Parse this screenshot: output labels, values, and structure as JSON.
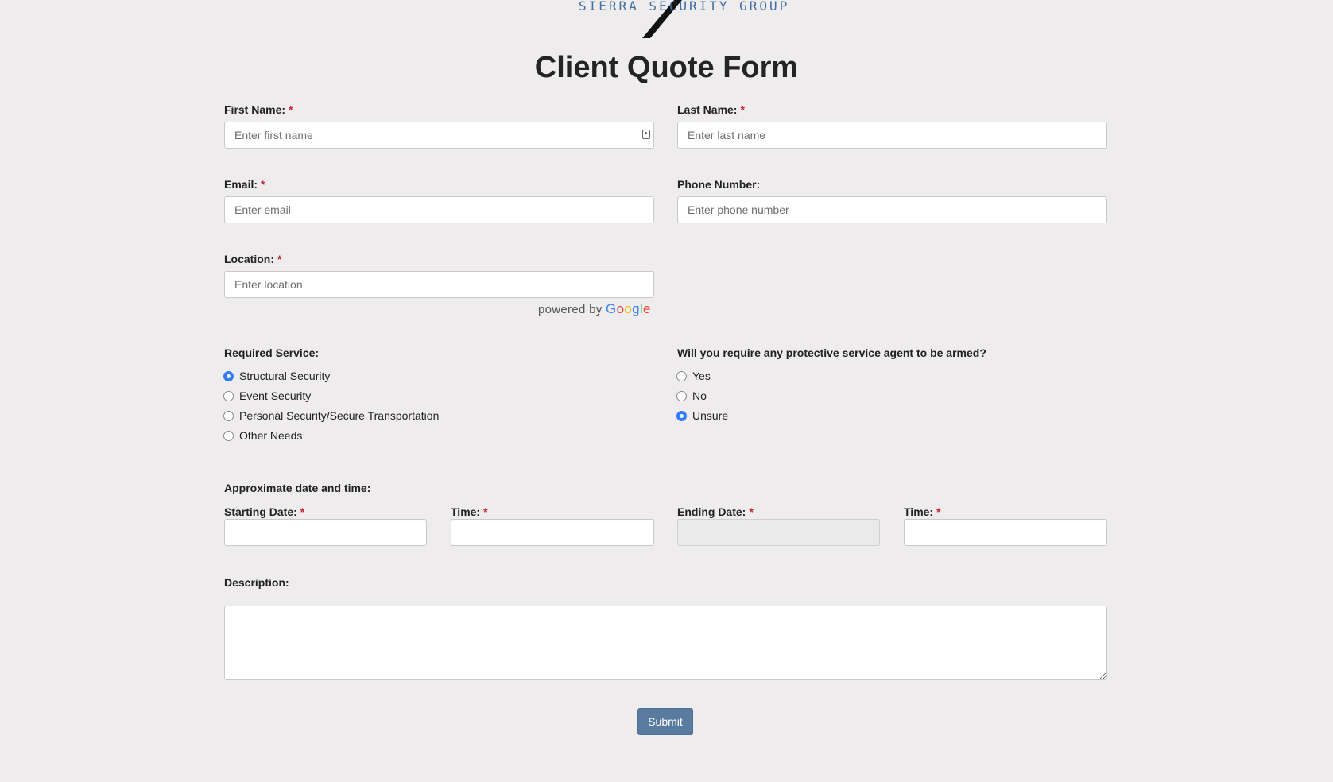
{
  "logo": {
    "text": "SIERRA SECURITY GROUP",
    "icon": "knife-slash-mark"
  },
  "form": {
    "title": "Client Quote Form",
    "required_marker": "*",
    "first_name": {
      "label": "First Name:",
      "placeholder": "Enter first name",
      "value": ""
    },
    "last_name": {
      "label": "Last Name:",
      "placeholder": "Enter last name",
      "value": ""
    },
    "email": {
      "label": "Email:",
      "placeholder": "Enter email",
      "value": ""
    },
    "phone": {
      "label": "Phone Number:",
      "placeholder": "Enter phone number",
      "value": ""
    },
    "location": {
      "label": "Location:",
      "placeholder": "Enter location",
      "value": ""
    },
    "powered_by": {
      "text": "powered by",
      "brand": [
        "G",
        "o",
        "o",
        "g",
        "l",
        "e"
      ],
      "brand_colors": [
        "#4285F4",
        "#EA4335",
        "#FBBC05",
        "#4285F4",
        "#34A853",
        "#EA4335"
      ]
    },
    "required_service": {
      "label": "Required Service:",
      "options": [
        {
          "label": "Structural Security",
          "checked": true
        },
        {
          "label": "Event Security",
          "checked": false
        },
        {
          "label": "Personal Security/Secure Transportation",
          "checked": false
        },
        {
          "label": "Other Needs",
          "checked": false
        }
      ]
    },
    "armed": {
      "label": "Will you require any protective service agent to be armed?",
      "options": [
        {
          "label": "Yes",
          "checked": false
        },
        {
          "label": "No",
          "checked": false
        },
        {
          "label": "Unsure",
          "checked": true
        }
      ]
    },
    "date_time": {
      "section_label": "Approximate date and time:",
      "starting_date": {
        "label": "Starting Date:",
        "value": ""
      },
      "start_time": {
        "label": "Time:",
        "value": ""
      },
      "ending_date": {
        "label": "Ending Date:",
        "value": "",
        "disabled": true
      },
      "end_time": {
        "label": "Time:",
        "value": ""
      }
    },
    "description": {
      "label": "Description:",
      "value": ""
    },
    "submit_label": "Submit"
  },
  "colors": {
    "background": "#eeeced",
    "required": "#c0262d",
    "radio_checked": "#2f7cf6",
    "submit": "#5a7ba0",
    "logo_text": "#3f6fa3"
  }
}
